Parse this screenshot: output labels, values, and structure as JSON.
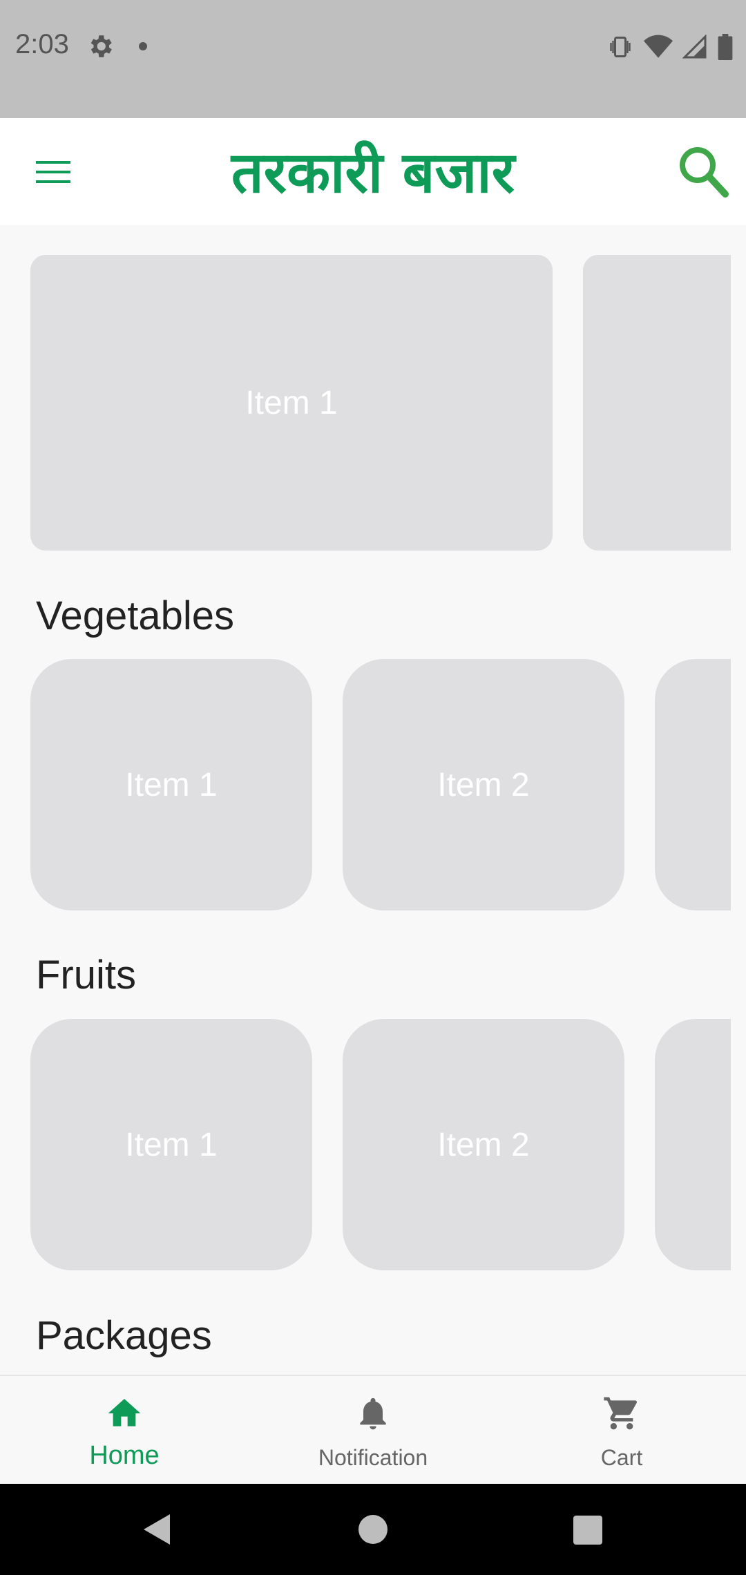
{
  "status_bar": {
    "time": "2:03"
  },
  "app_bar": {
    "title": "तरकारी बजार"
  },
  "banner": {
    "items": [
      "Item 1",
      ""
    ]
  },
  "sections": [
    {
      "title": "Vegetables",
      "items": [
        "Item 1",
        "Item 2",
        ""
      ]
    },
    {
      "title": "Fruits",
      "items": [
        "Item 1",
        "Item 2",
        ""
      ]
    },
    {
      "title": "Packages"
    }
  ],
  "bottom_nav": {
    "items": [
      {
        "label": "Home",
        "icon": "home-icon",
        "active": true
      },
      {
        "label": "Notification",
        "icon": "bell-icon",
        "active": false
      },
      {
        "label": "Cart",
        "icon": "cart-icon",
        "active": false
      }
    ]
  },
  "colors": {
    "accent": "#0d9b57",
    "card": "#dfdee0",
    "background": "#f8f8f8"
  }
}
